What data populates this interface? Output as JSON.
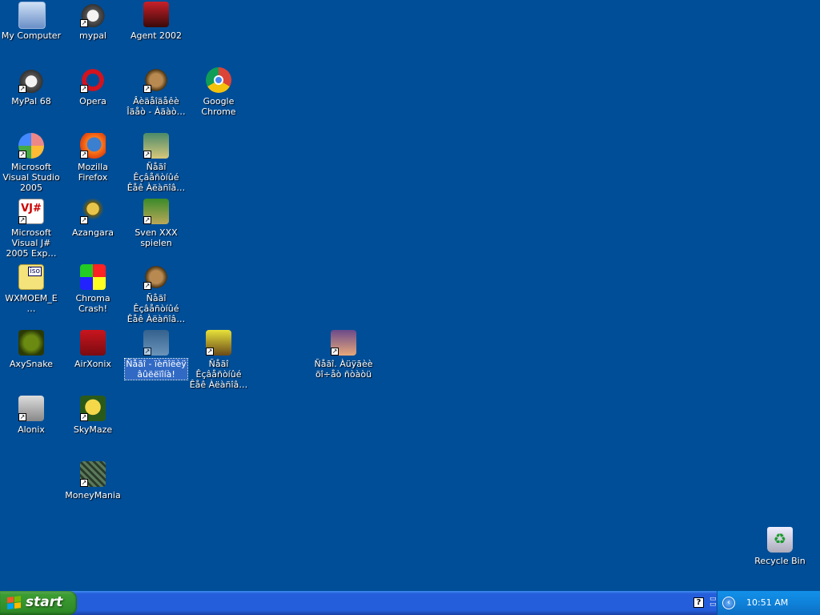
{
  "desktop": {
    "icons": [
      {
        "label": "My Computer",
        "icon": "computer-icon",
        "shortcut": false
      },
      {
        "label": "mypal",
        "icon": "raccoon-icon",
        "shortcut": true
      },
      {
        "label": "Agent 2002",
        "icon": "agent-icon",
        "shortcut": false
      },
      {
        "label": "MyPal 68",
        "icon": "raccoon-icon",
        "shortcut": true
      },
      {
        "label": "Opera",
        "icon": "opera-icon",
        "shortcut": true
      },
      {
        "label": "Âèäåîäåêè Îäåò - Àäàò…",
        "icon": "cartoon-icon",
        "shortcut": true
      },
      {
        "label": "Google Chrome",
        "icon": "chrome-icon",
        "shortcut": false
      },
      {
        "label": "Microsoft Visual Studio 2005",
        "icon": "visual-studio-icon",
        "shortcut": true
      },
      {
        "label": "Mozilla Firefox",
        "icon": "firefox-icon",
        "shortcut": true
      },
      {
        "label": "Ñåãî Êçâåñòíûé Êåê Àëàñîâ…",
        "icon": "cartoon-icon",
        "shortcut": true
      },
      {
        "label": "Microsoft Visual J# 2005 Exp…",
        "icon": "vj-icon",
        "shortcut": true
      },
      {
        "label": "Azangara",
        "icon": "azangara-icon",
        "shortcut": true
      },
      {
        "label": "Sven XXX spielen",
        "icon": "sheep-icon",
        "shortcut": true
      },
      {
        "label": "WXMOEM_E…",
        "icon": "iso-file-icon",
        "shortcut": false
      },
      {
        "label": "Chroma Crash!",
        "icon": "chroma-crash-icon",
        "shortcut": false
      },
      {
        "label": "Ñåãî Êçâåñòíûé Êåê Àëàñîâ…",
        "icon": "cartoon-icon",
        "shortcut": true
      },
      {
        "label": "AxySnake",
        "icon": "axysnake-icon",
        "shortcut": false
      },
      {
        "label": "AirXonix",
        "icon": "airxonix-icon",
        "shortcut": false
      },
      {
        "label": "Ñåãî - ïèñîëèÿ âûëëïîíà!",
        "icon": "cartoon-icon",
        "shortcut": true,
        "selected": true
      },
      {
        "label": "Ñåãî Êçâåñòíûé Êåê Àëàñîâ…",
        "icon": "cartoon-icon",
        "shortcut": true
      },
      {
        "label": "Ñåãî. Àüÿãèè õî÷åò ñòàòü",
        "icon": "cartoon-icon",
        "shortcut": true
      },
      {
        "label": "Alonix",
        "icon": "alonix-icon",
        "shortcut": true
      },
      {
        "label": "SkyMaze",
        "icon": "skymaze-icon",
        "shortcut": true
      },
      {
        "label": "MoneyMania",
        "icon": "moneymania-icon",
        "shortcut": true
      },
      {
        "label": "Recycle Bin",
        "icon": "recycle-bin-icon",
        "shortcut": false
      }
    ]
  },
  "taskbar": {
    "start_label": "start",
    "clock": "10:51 AM",
    "help_glyph": "?",
    "chevron_glyph": "‹"
  },
  "colors": {
    "desktop_background": "#004e98",
    "taskbar_blue": "#245edb",
    "start_green": "#3c9d33",
    "tray_blue": "#0f82d9",
    "selection": "#316ac5"
  }
}
